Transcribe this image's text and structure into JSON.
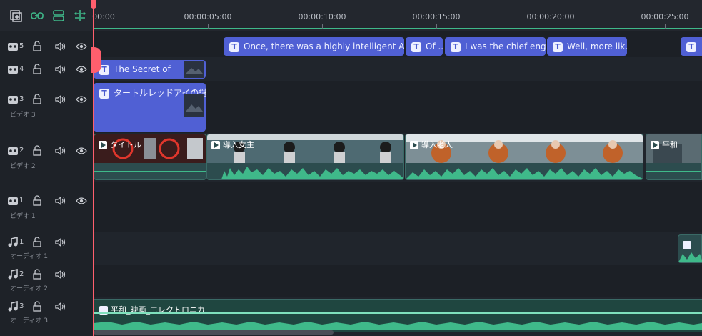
{
  "ruler": {
    "labels": [
      "00:00",
      "00:00:05:00",
      "00:00:10:00",
      "00:00:15:00",
      "00:00:20:00",
      "00:00:25:00"
    ]
  },
  "tracks": {
    "video5": {
      "num": "5"
    },
    "video4": {
      "num": "4"
    },
    "video3": {
      "num": "3",
      "name": "ビデオ 3"
    },
    "video2": {
      "num": "2",
      "name": "ビデオ 2"
    },
    "video1": {
      "num": "1",
      "name": "ビデオ 1"
    },
    "audio1": {
      "num": "1",
      "name": "オーディオ 1"
    },
    "audio2": {
      "num": "2",
      "name": "オーディオ 2"
    },
    "audio3": {
      "num": "3",
      "name": "オーディオ 3"
    }
  },
  "clips": {
    "t5a": "Once, there was a highly intelligent AI cal...",
    "t5b": "Of ...",
    "t5c": "I was the chief engi...",
    "t5d": "Well, more lik...",
    "t4": "The Secret of",
    "t3": "タートルレッドアイの謎",
    "v2a": "タイトル",
    "v2b": "導入女主",
    "v2c": "導入老人",
    "v2d": "平和",
    "audio3_clip": "平和_映画_エレクトロニカ"
  },
  "colors": {
    "accent": "#3fb98a",
    "title_clip": "#5060d4",
    "playhead": "#ff5f6d"
  }
}
